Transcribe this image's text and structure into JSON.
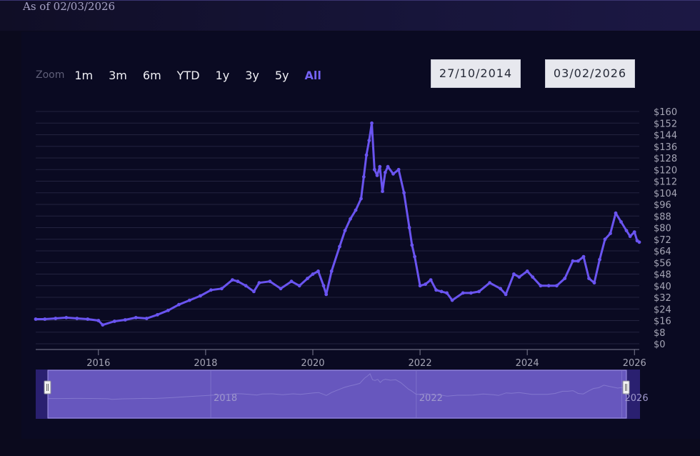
{
  "header": {
    "as_of": "As of 02/03/2026"
  },
  "zoom": {
    "label": "Zoom",
    "buttons": [
      "1m",
      "3m",
      "6m",
      "YTD",
      "1y",
      "3y",
      "5y",
      "All"
    ],
    "active": "All"
  },
  "range": {
    "from": "27/10/2014",
    "to": "03/02/2026"
  },
  "colors": {
    "line": "#6a54f0",
    "active": "#7563f5",
    "navigator_fill": "#6f5fc8"
  },
  "chart_data": {
    "type": "line",
    "title": "",
    "xlabel": "",
    "ylabel": "",
    "ylim": [
      0,
      160
    ],
    "xlim": [
      2014.83,
      2026.09
    ],
    "y_ticks": [
      0,
      8,
      16,
      24,
      32,
      40,
      48,
      56,
      64,
      72,
      80,
      88,
      96,
      104,
      112,
      120,
      128,
      136,
      144,
      152,
      160
    ],
    "y_tick_labels": [
      "$0",
      "$8",
      "$16",
      "$24",
      "$32",
      "$40",
      "$48",
      "$56",
      "$64",
      "$72",
      "$80",
      "$88",
      "$96",
      "$104",
      "$112",
      "$120",
      "$128",
      "$136",
      "$144",
      "$152",
      "$160"
    ],
    "x_ticks": [
      2016,
      2018,
      2020,
      2022,
      2024,
      2026
    ],
    "x_tick_labels": [
      "2016",
      "2018",
      "2020",
      "2022",
      "2024",
      "2026"
    ],
    "navigator_labels": [
      "2018",
      "2022",
      "2026"
    ],
    "grid": true,
    "series": [
      {
        "x": [
          2014.83,
          2015.0,
          2015.2,
          2015.4,
          2015.6,
          2015.8,
          2016.0,
          2016.08,
          2016.3,
          2016.5,
          2016.7,
          2016.9,
          2017.1,
          2017.3,
          2017.5,
          2017.7,
          2017.9,
          2018.1,
          2018.3,
          2018.5,
          2018.6,
          2018.75,
          2018.9,
          2019.0,
          2019.2,
          2019.4,
          2019.6,
          2019.75,
          2019.9,
          2020.0,
          2020.1,
          2020.2,
          2020.25,
          2020.35,
          2020.5,
          2020.6,
          2020.7,
          2020.8,
          2020.9,
          2020.95,
          2021.0,
          2021.05,
          2021.1,
          2021.15,
          2021.2,
          2021.25,
          2021.3,
          2021.35,
          2021.4,
          2021.5,
          2021.6,
          2021.7,
          2021.8,
          2021.85,
          2021.9,
          2022.0,
          2022.1,
          2022.2,
          2022.3,
          2022.4,
          2022.5,
          2022.6,
          2022.8,
          2022.95,
          2023.1,
          2023.3,
          2023.5,
          2023.6,
          2023.75,
          2023.85,
          2024.0,
          2024.1,
          2024.25,
          2024.4,
          2024.55,
          2024.7,
          2024.85,
          2024.95,
          2025.05,
          2025.15,
          2025.25,
          2025.35,
          2025.45,
          2025.55,
          2025.65,
          2025.75,
          2025.85,
          2025.92,
          2026.0,
          2026.05,
          2026.09
        ],
        "values": [
          17,
          17,
          17.5,
          18,
          17.5,
          17,
          16,
          13,
          15.5,
          16.5,
          18,
          17.5,
          20,
          23,
          27,
          30,
          33,
          37,
          38,
          44,
          43,
          40,
          36,
          42,
          43,
          38,
          43,
          40,
          45,
          48,
          50,
          40,
          34,
          50,
          67,
          78,
          86,
          92,
          100,
          115,
          130,
          140,
          152,
          120,
          116,
          122,
          105,
          118,
          122,
          117,
          120,
          104,
          80,
          68,
          60,
          40,
          41,
          44,
          37,
          36,
          35,
          30,
          35,
          35,
          36,
          42,
          38,
          34,
          48,
          46,
          50,
          46,
          40,
          40,
          40,
          45,
          57,
          57,
          60,
          45,
          42,
          58,
          72,
          76,
          90,
          84,
          78,
          74,
          77,
          71,
          70
        ]
      }
    ]
  }
}
